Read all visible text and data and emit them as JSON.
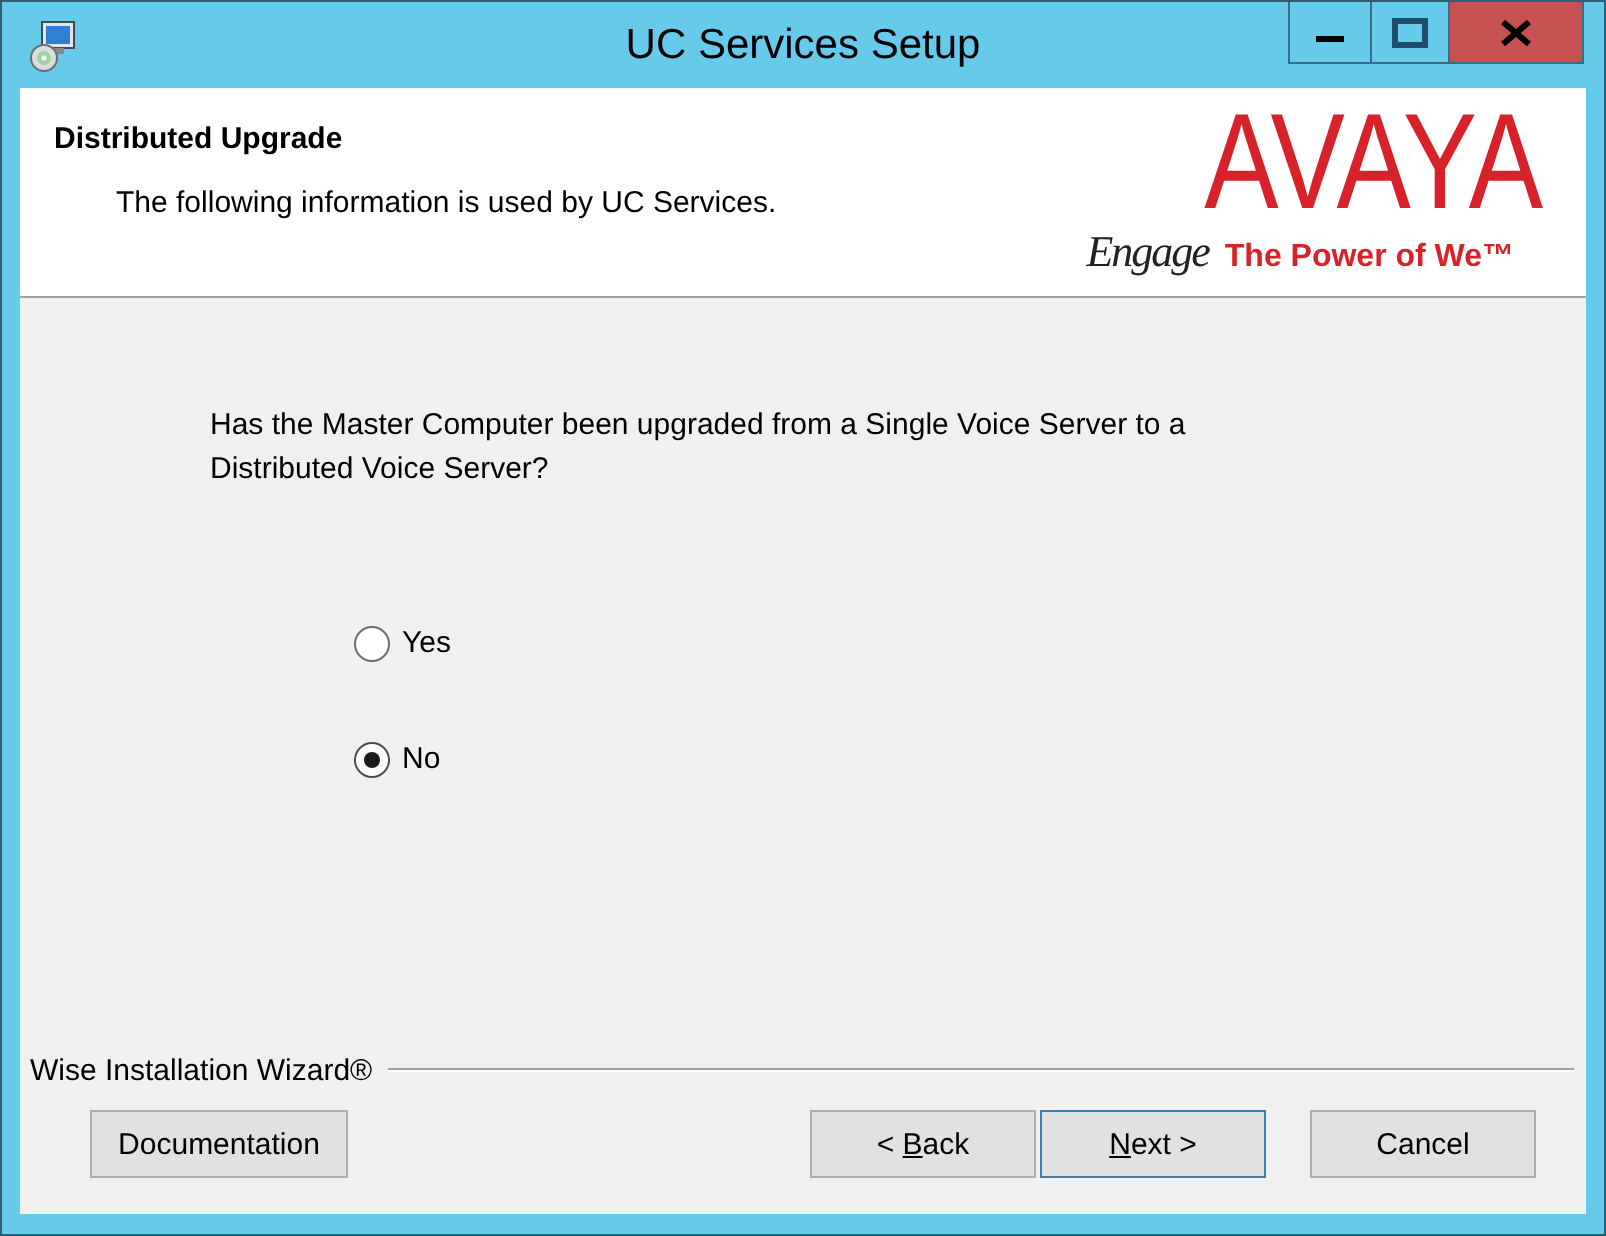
{
  "window": {
    "title": "UC Services Setup"
  },
  "header": {
    "title": "Distributed Upgrade",
    "subtitle": "The following information is used by UC Services.",
    "logo": {
      "wordmark": "AVAYA",
      "script": "Engage",
      "tagline": "The Power of We™"
    }
  },
  "question": {
    "text": "Has the Master Computer been upgraded from a Single Voice Server to a Distributed Voice Server?",
    "options": [
      {
        "label": "Yes",
        "selected": false
      },
      {
        "label": "No",
        "selected": true
      }
    ]
  },
  "footer": {
    "brand": "Wise Installation Wizard®",
    "left_buttons": [
      {
        "label": "Documentation",
        "default": false
      }
    ],
    "right_buttons": [
      {
        "text_before": "< ",
        "access_key": "B",
        "text_after": "ack",
        "default": false
      },
      {
        "access_key": "N",
        "text_after": "ext >",
        "default": true
      },
      {
        "label": "Cancel",
        "default": false
      }
    ]
  }
}
